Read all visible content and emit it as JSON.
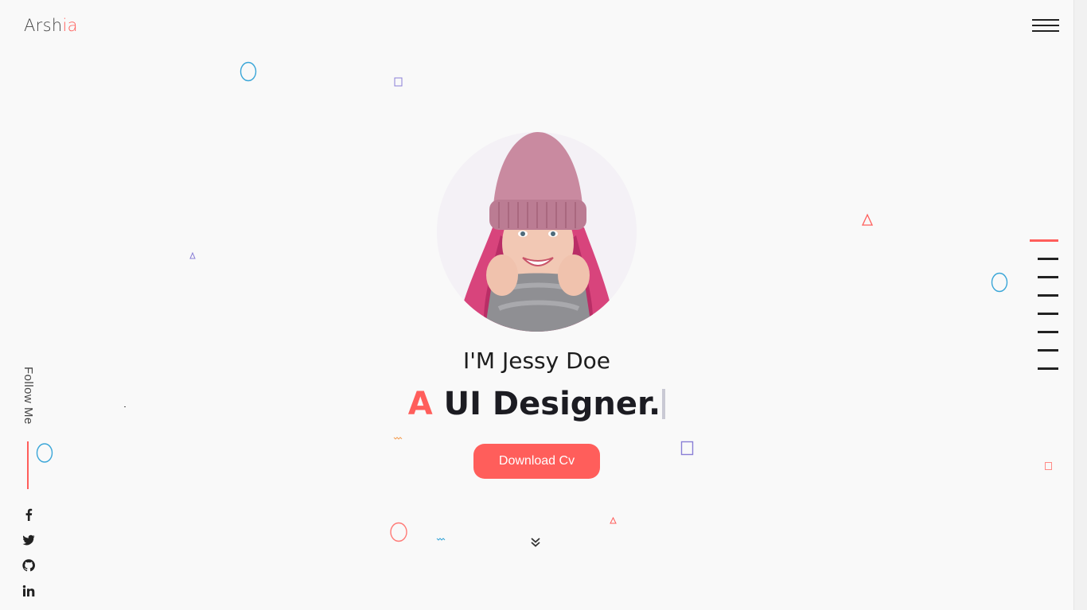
{
  "header": {
    "logo_main": "Arsh",
    "logo_accent": "ia",
    "menu_icon": "hamburger-icon"
  },
  "hero": {
    "name": "I'M Jessy Doe",
    "role_prefix": "A",
    "role_text": "UI Designer.",
    "cta_label": "Download Cv",
    "scroll_icon": "double-chevron-down-icon"
  },
  "sidebar": {
    "follow_label": "Follow Me",
    "social": [
      {
        "icon": "facebook-icon"
      },
      {
        "icon": "twitter-icon"
      },
      {
        "icon": "github-icon"
      },
      {
        "icon": "linkedin-icon"
      }
    ]
  },
  "section_nav": {
    "items": 8,
    "active_index": 0
  },
  "colors": {
    "accent": "#ff5e5b",
    "text_dark": "#1c1c22",
    "background": "#f9f9f9",
    "shape_blue": "#3aa6d8",
    "shape_purple": "#8a7fd6"
  }
}
